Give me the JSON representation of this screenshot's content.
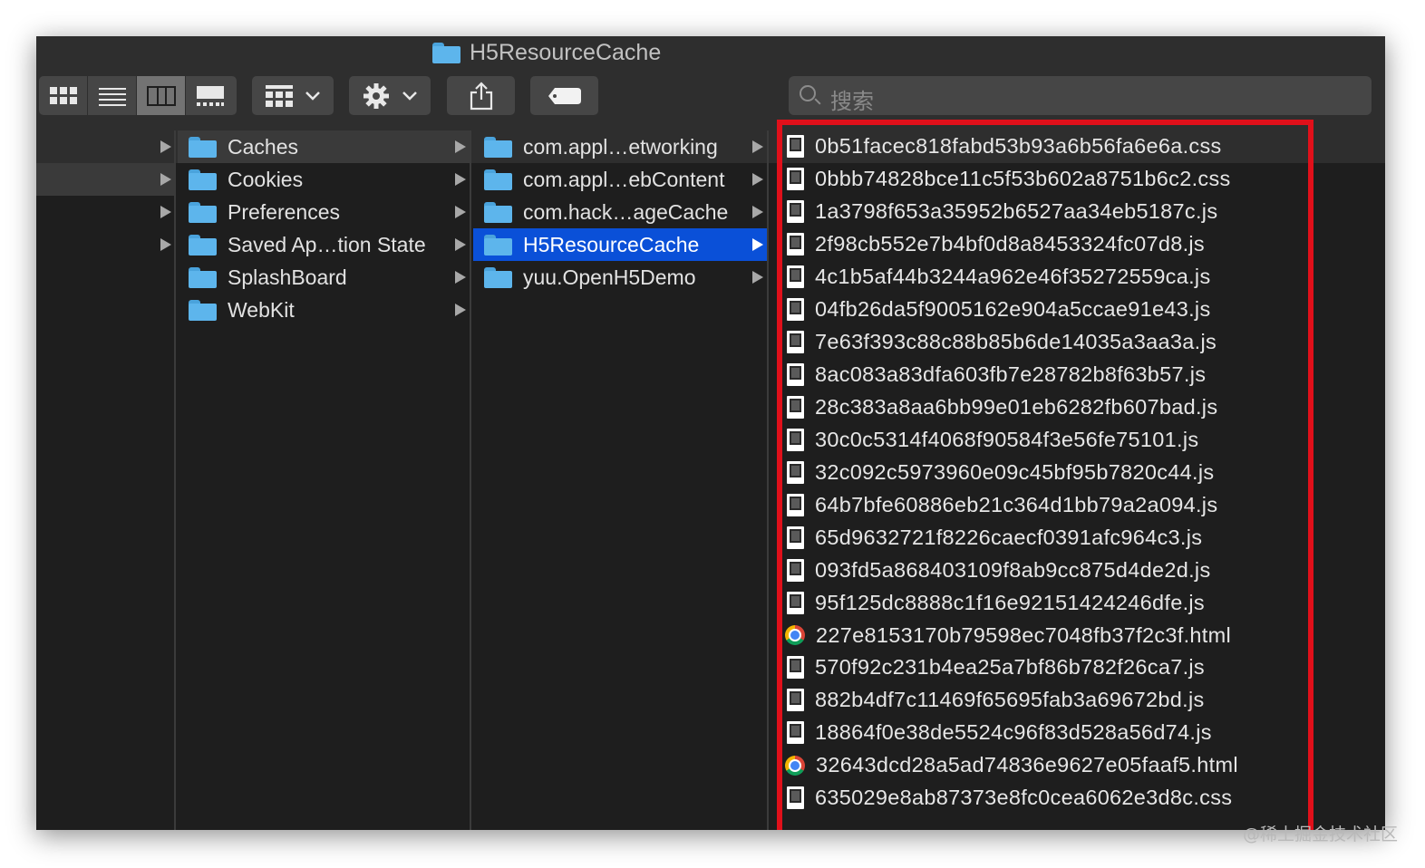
{
  "window": {
    "title": "H5ResourceCache"
  },
  "toolbar": {
    "view_modes": [
      "icon-view",
      "list-view",
      "column-view",
      "gallery-view"
    ],
    "selected_view": "column-view",
    "search_placeholder": "搜索"
  },
  "columns": {
    "col2": [
      {
        "label": "Caches",
        "state": "gray"
      },
      {
        "label": "Cookies",
        "state": "none"
      },
      {
        "label": "Preferences",
        "state": "none"
      },
      {
        "label": "Saved Ap…tion State",
        "state": "none"
      },
      {
        "label": "SplashBoard",
        "state": "none"
      },
      {
        "label": "WebKit",
        "state": "none"
      }
    ],
    "col3": [
      {
        "label": "com.appl…etworking",
        "state": "none"
      },
      {
        "label": "com.appl…ebContent",
        "state": "none"
      },
      {
        "label": "com.hack…ageCache",
        "state": "none"
      },
      {
        "label": "H5ResourceCache",
        "state": "blue"
      },
      {
        "label": "yuu.OpenH5Demo",
        "state": "none"
      }
    ],
    "files": [
      {
        "name": "0b51facec818fabd53b93a6b56fa6e6a.css",
        "icon": "document-icon"
      },
      {
        "name": "0bbb74828bce11c5f53b602a8751b6c2.css",
        "icon": "document-icon"
      },
      {
        "name": "1a3798f653a35952b6527aa34eb5187c.js",
        "icon": "document-icon"
      },
      {
        "name": "2f98cb552e7b4bf0d8a8453324fc07d8.js",
        "icon": "document-icon"
      },
      {
        "name": "4c1b5af44b3244a962e46f35272559ca.js",
        "icon": "document-icon"
      },
      {
        "name": "04fb26da5f9005162e904a5ccae91e43.js",
        "icon": "document-icon"
      },
      {
        "name": "7e63f393c88c88b85b6de14035a3aa3a.js",
        "icon": "document-icon"
      },
      {
        "name": "8ac083a83dfa603fb7e28782b8f63b57.js",
        "icon": "document-icon"
      },
      {
        "name": "28c383a8aa6bb99e01eb6282fb607bad.js",
        "icon": "document-icon"
      },
      {
        "name": "30c0c5314f4068f90584f3e56fe75101.js",
        "icon": "document-icon"
      },
      {
        "name": "32c092c5973960e09c45bf95b7820c44.js",
        "icon": "document-icon"
      },
      {
        "name": "64b7bfe60886eb21c364d1bb79a2a094.js",
        "icon": "document-icon"
      },
      {
        "name": "65d9632721f8226caecf0391afc964c3.js",
        "icon": "document-icon"
      },
      {
        "name": "093fd5a868403109f8ab9cc875d4de2d.js",
        "icon": "document-icon"
      },
      {
        "name": "95f125dc8888c1f16e92151424246dfe.js",
        "icon": "document-icon"
      },
      {
        "name": "227e8153170b79598ec7048fb37f2c3f.html",
        "icon": "chrome-icon"
      },
      {
        "name": "570f92c231b4ea25a7bf86b782f26ca7.js",
        "icon": "document-icon"
      },
      {
        "name": "882b4df7c11469f65695fab3a69672bd.js",
        "icon": "document-icon"
      },
      {
        "name": "18864f0e38de5524c96f83d528a56d74.js",
        "icon": "document-icon"
      },
      {
        "name": "32643dcd28a5ad74836e9627e05faaf5.html",
        "icon": "chrome-icon"
      },
      {
        "name": "635029e8ab87373e8fc0cea6062e3d8c.css",
        "icon": "document-icon"
      }
    ]
  },
  "highlight_color": "#e0101a",
  "watermark": "@稀土掘金技术社区"
}
